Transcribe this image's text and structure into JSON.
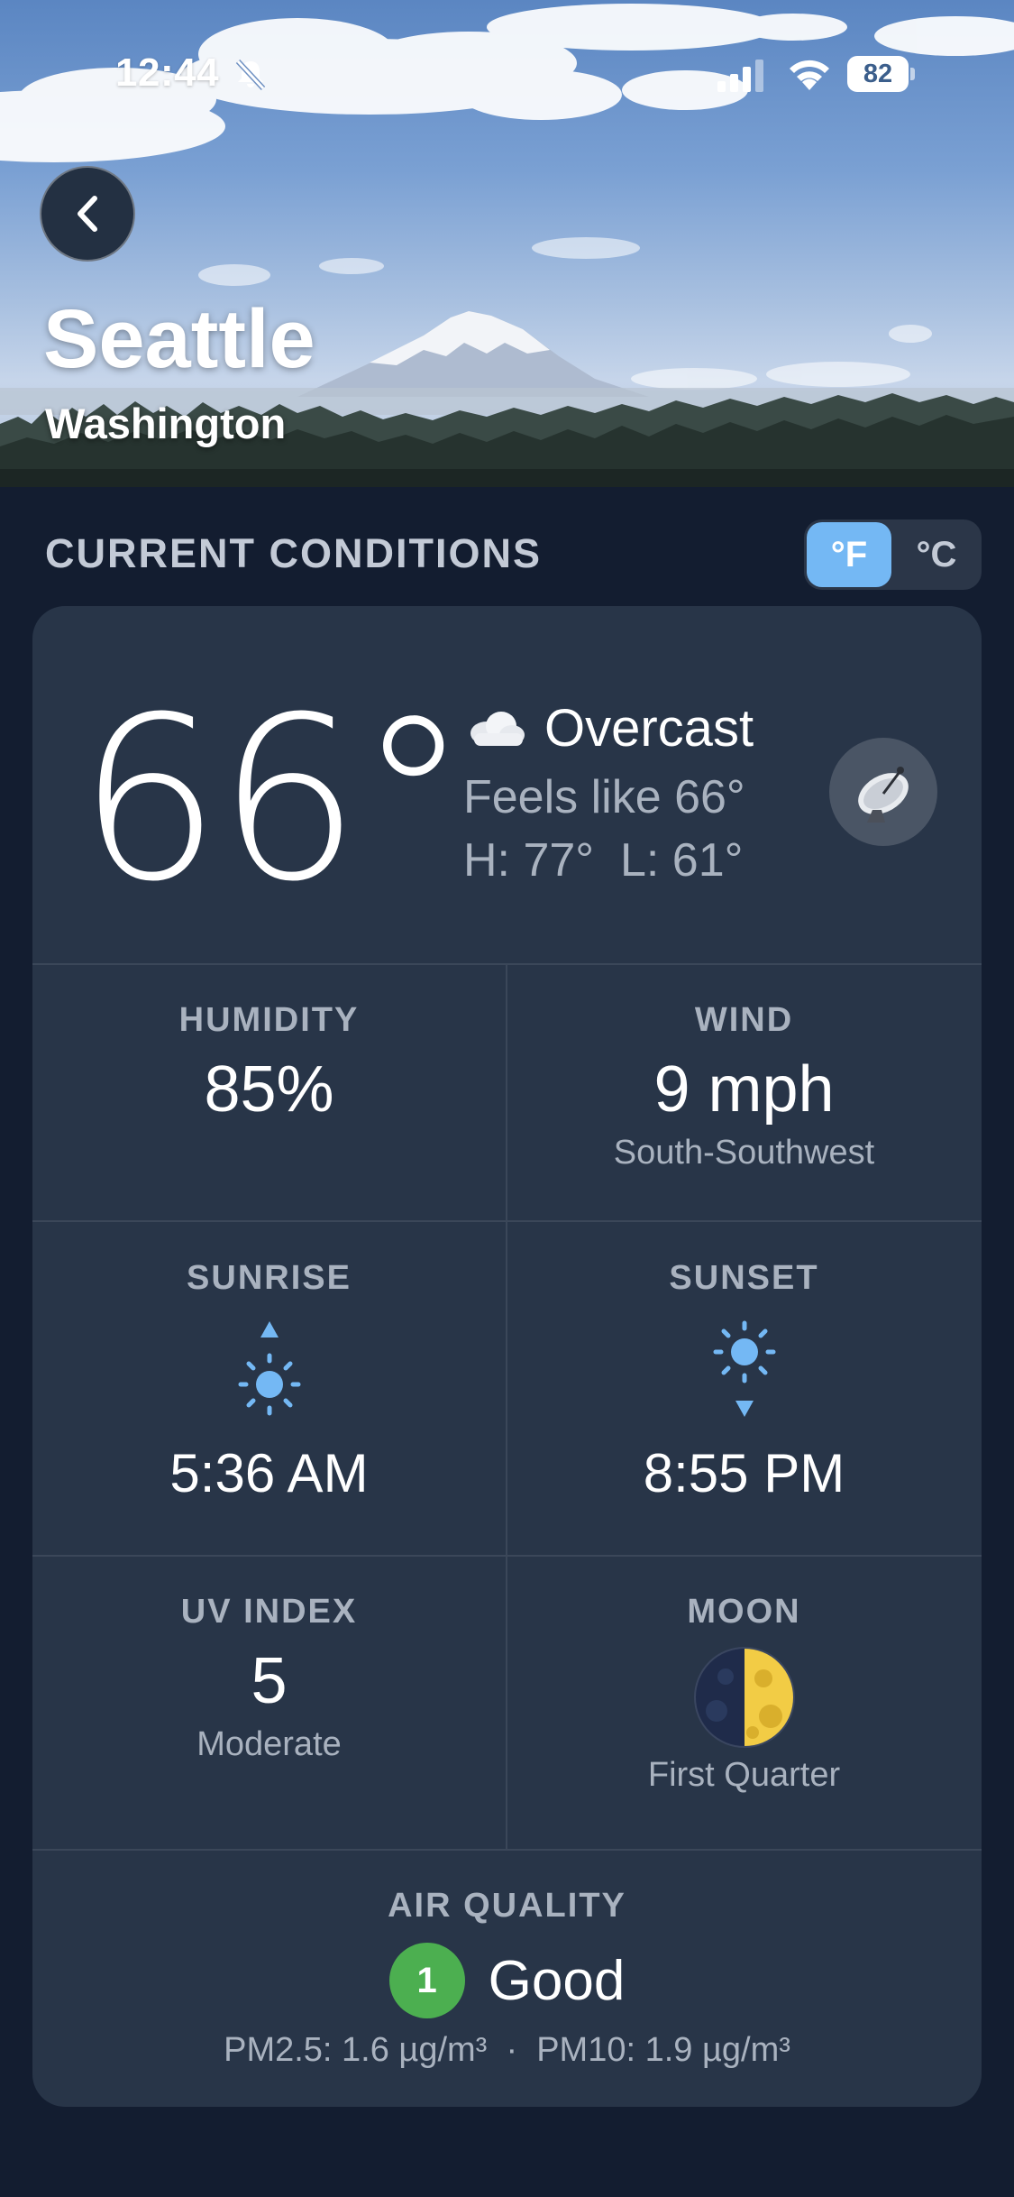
{
  "status_bar": {
    "time": "12:44",
    "battery": "82",
    "icons": [
      "bell-slash-icon",
      "signal-icon",
      "wifi-icon",
      "battery-icon"
    ]
  },
  "header": {
    "back_icon": "chevron-left-icon",
    "city": "Seattle",
    "region": "Washington"
  },
  "section": {
    "title": "CURRENT CONDITIONS",
    "units": {
      "fahrenheit": "°F",
      "celsius": "°C",
      "selected": "°F"
    }
  },
  "current": {
    "temperature": "66°",
    "condition_icon": "cloud-icon",
    "condition": "Overcast",
    "feels_like": "Feels like 66°",
    "high_low": "H: 77°  L: 61°",
    "radar_icon": "satellite-dish-icon"
  },
  "humidity": {
    "label": "HUMIDITY",
    "value": "85%"
  },
  "wind": {
    "label": "WIND",
    "value": "9 mph",
    "direction": "South-Southwest"
  },
  "sunrise": {
    "label": "SUNRISE",
    "time": "5:36 AM",
    "icon": "sunrise-icon"
  },
  "sunset": {
    "label": "SUNSET",
    "time": "8:55 PM",
    "icon": "sunset-icon"
  },
  "uv": {
    "label": "UV INDEX",
    "value": "5",
    "level": "Moderate"
  },
  "moon": {
    "label": "MOON",
    "phase": "First Quarter",
    "icon": "first-quarter-moon-icon"
  },
  "air_quality": {
    "label": "AIR QUALITY",
    "index": "1",
    "status": "Good",
    "detail": "PM2.5: 1.6 µg/m³  ·  PM10: 1.9 µg/m³"
  },
  "colors": {
    "background": "#131d30",
    "card": "#283548",
    "accent": "#74b8f4",
    "aq_good": "#4caf50"
  }
}
